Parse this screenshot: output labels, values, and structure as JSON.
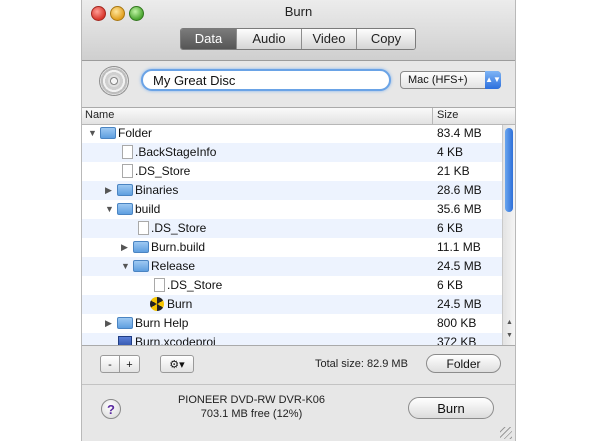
{
  "window": {
    "title": "Burn"
  },
  "tabs": [
    {
      "label": "Data",
      "active": true
    },
    {
      "label": "Audio",
      "active": false
    },
    {
      "label": "Video",
      "active": false
    },
    {
      "label": "Copy",
      "active": false
    }
  ],
  "disc": {
    "name_value": "My Great Disc",
    "filesystem": "Mac (HFS+)"
  },
  "columns": {
    "name": "Name",
    "size": "Size"
  },
  "rows": [
    {
      "name": "Folder",
      "size": "83.4 MB",
      "icon": "folder-icon",
      "disclosure": "expanded"
    },
    {
      "name": ".BackStageInfo",
      "size": "4 KB",
      "icon": "document-icon",
      "disclosure": "none"
    },
    {
      "name": ".DS_Store",
      "size": "21 KB",
      "icon": "document-icon",
      "disclosure": "none"
    },
    {
      "name": "Binaries",
      "size": "28.6 MB",
      "icon": "folder-icon",
      "disclosure": "collapsed"
    },
    {
      "name": "build",
      "size": "35.6 MB",
      "icon": "folder-icon",
      "disclosure": "expanded"
    },
    {
      "name": ".DS_Store",
      "size": "6 KB",
      "icon": "document-icon",
      "disclosure": "none"
    },
    {
      "name": "Burn.build",
      "size": "11.1 MB",
      "icon": "folder-icon",
      "disclosure": "collapsed"
    },
    {
      "name": "Release",
      "size": "24.5 MB",
      "icon": "folder-icon",
      "disclosure": "expanded"
    },
    {
      "name": ".DS_Store",
      "size": "6 KB",
      "icon": "document-icon",
      "disclosure": "none"
    },
    {
      "name": "Burn",
      "size": "24.5 MB",
      "icon": "burn-app-icon",
      "disclosure": "none"
    },
    {
      "name": "Burn Help",
      "size": "800 KB",
      "icon": "folder-icon",
      "disclosure": "collapsed"
    },
    {
      "name": "Burn.xcodeproj",
      "size": "372 KB",
      "icon": "xcodeproj-icon",
      "disclosure": "none"
    }
  ],
  "toolbar": {
    "minus": "-",
    "plus": "+",
    "gear": "⚙▾",
    "total_size": "Total size: 82.9 MB",
    "folder_button": "Folder"
  },
  "status": {
    "help": "?",
    "drive": "PIONEER DVD-RW DVR-K06",
    "free": "703.1 MB free (12%)",
    "burn_button": "Burn"
  },
  "colors": {
    "accent": "#6aa3e6",
    "selected_tab": "#5a5a5a",
    "row_alt": "#edf3fe"
  }
}
